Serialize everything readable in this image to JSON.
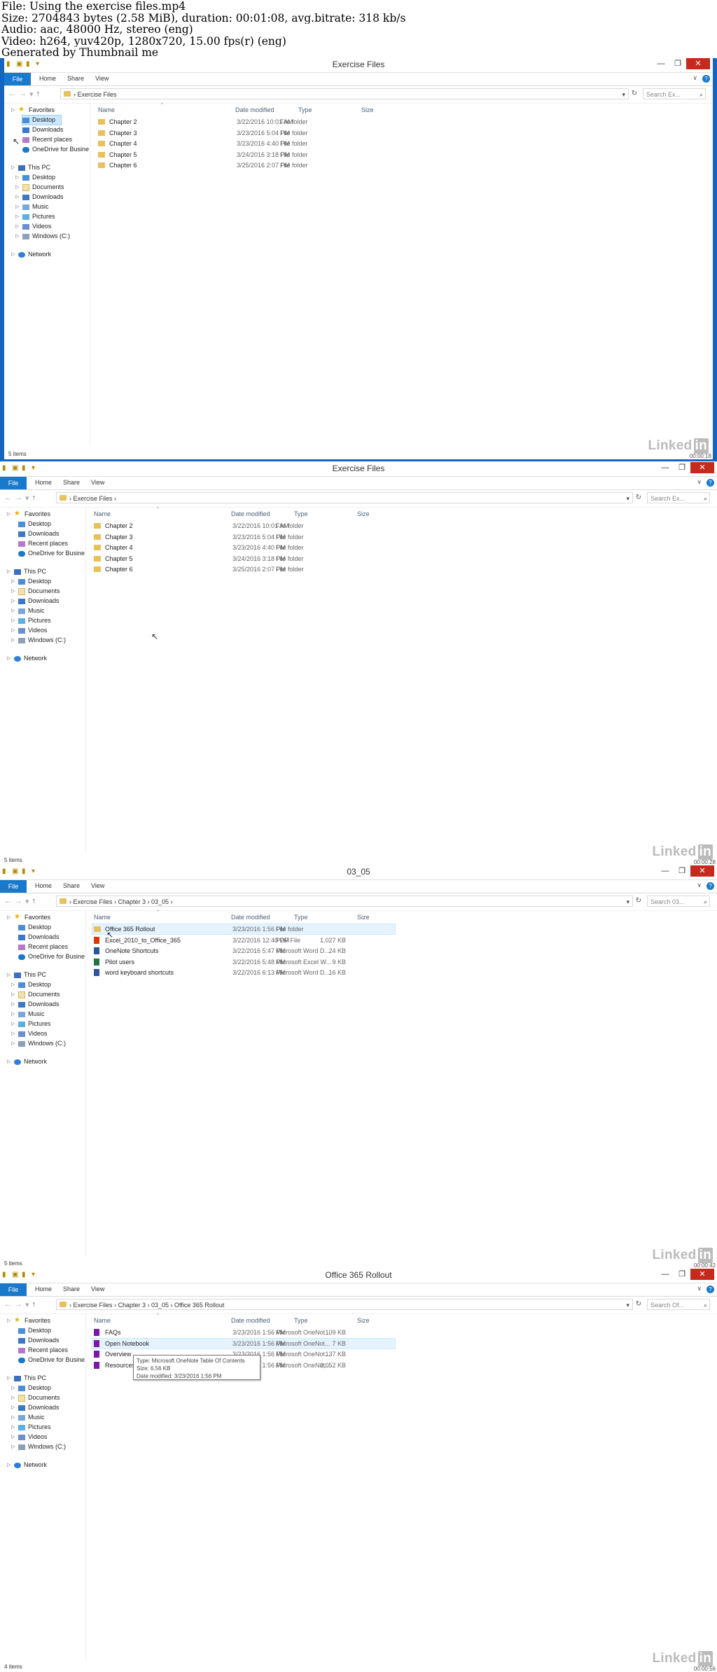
{
  "header": {
    "line1": "File: Using the exercise files.mp4",
    "line2": "Size: 2704843 bytes (2.58 MiB), duration: 00:01:08, avg.bitrate: 318 kb/s",
    "line3": "Audio: aac, 48000 Hz, stereo (eng)",
    "line4": "Video: h264, yuv420p, 1280x720, 15.00 fps(r) (eng)",
    "line5": "Generated by Thumbnail me"
  },
  "ribbon": {
    "file": "File",
    "home": "Home",
    "share": "Share",
    "view": "View"
  },
  "columns": {
    "name": "Name",
    "date": "Date modified",
    "type": "Type",
    "size": "Size"
  },
  "nav_pane": {
    "favorites": "Favorites",
    "desktop": "Desktop",
    "downloads": "Downloads",
    "recent": "Recent places",
    "onedrive": "OneDrive for Busine",
    "thispc": "This PC",
    "pc_desktop": "Desktop",
    "documents": "Documents",
    "pc_downloads": "Downloads",
    "music": "Music",
    "pictures": "Pictures",
    "videos": "Videos",
    "drive_c": "Windows (C:)",
    "network": "Network"
  },
  "branding": {
    "logo_text": "Linked",
    "logo_in": "in"
  },
  "frames": [
    {
      "title": "Exercise Files",
      "address": "›  Exercise Files",
      "search_placeholder": "Search Ex...",
      "status": "5 items",
      "timestamp": "00:00:18",
      "rows": [
        {
          "name": "Chapter 2",
          "date": "3/22/2016 10:01 AM",
          "type": "File folder",
          "size": ""
        },
        {
          "name": "Chapter 3",
          "date": "3/23/2016 5:04 PM",
          "type": "File folder",
          "size": ""
        },
        {
          "name": "Chapter 4",
          "date": "3/23/2016 4:40 PM",
          "type": "File folder",
          "size": ""
        },
        {
          "name": "Chapter 5",
          "date": "3/24/2016 3:18 PM",
          "type": "File folder",
          "size": ""
        },
        {
          "name": "Chapter 6",
          "date": "3/25/2016 2:07 PM",
          "type": "File folder",
          "size": ""
        }
      ]
    },
    {
      "title": "Exercise Files",
      "address": "›  Exercise Files  ›",
      "search_placeholder": "Search Ex...",
      "status": "5 items",
      "timestamp": "00:00:28",
      "rows": [
        {
          "name": "Chapter 2",
          "date": "3/22/2016 10:01 AM",
          "type": "File folder",
          "size": ""
        },
        {
          "name": "Chapter 3",
          "date": "3/23/2016 5:04 PM",
          "type": "File folder",
          "size": ""
        },
        {
          "name": "Chapter 4",
          "date": "3/23/2016 4:40 PM",
          "type": "File folder",
          "size": ""
        },
        {
          "name": "Chapter 5",
          "date": "3/24/2016 3:18 PM",
          "type": "File folder",
          "size": ""
        },
        {
          "name": "Chapter 6",
          "date": "3/25/2016 2:07 PM",
          "type": "File folder",
          "size": ""
        }
      ]
    },
    {
      "title": "03_05",
      "address": "›  Exercise Files  ›  Chapter 3  ›  03_05  ›",
      "search_placeholder": "Search 03...",
      "status": "5 items",
      "timestamp": "00:00:42",
      "rows": [
        {
          "name": "Office 365 Rollout",
          "date": "3/23/2016 1:56 PM",
          "type": "File folder",
          "size": ""
        },
        {
          "name": "Excel_2010_to_Office_365",
          "date": "3/22/2016 12:40 PM",
          "type": "PDF File",
          "size": "1,027 KB"
        },
        {
          "name": "OneNote Shortcuts",
          "date": "3/22/2016 5:47 PM",
          "type": "Microsoft Word D...",
          "size": "24 KB"
        },
        {
          "name": "Pilot users",
          "date": "3/22/2016 5:48 PM",
          "type": "Microsoft Excel W...",
          "size": "9 KB"
        },
        {
          "name": "word keyboard shortcuts",
          "date": "3/22/2016 6:13 PM",
          "type": "Microsoft Word D...",
          "size": "16 KB"
        }
      ]
    },
    {
      "title": "Office 365 Rollout",
      "address": "›  Exercise Files  ›  Chapter 3  ›  03_05  ›  Office 365 Rollout",
      "search_placeholder": "Search Of...",
      "status": "4 items",
      "timestamp": "00:00:56",
      "rows": [
        {
          "name": "FAQs",
          "date": "3/23/2016 1:56 PM",
          "type": "Microsoft OneNot...",
          "size": "109 KB"
        },
        {
          "name": "Open Notebook",
          "date": "3/23/2016 1:56 PM",
          "type": "Microsoft OneNot...",
          "size": "7 KB"
        },
        {
          "name": "Overview",
          "date": "3/23/2016 1:56 PM",
          "type": "Microsoft OneNot...",
          "size": "137 KB"
        },
        {
          "name": "Resources",
          "date": "3/23/2016 1:56 PM",
          "type": "Microsoft OneNot...",
          "size": "2,052 KB"
        }
      ]
    }
  ],
  "tooltip": {
    "line1": "Type: Microsoft OneNote Table Of Contents",
    "line2": "Size: 6.56 KB",
    "line3": "Date modified: 3/23/2016 1:56 PM"
  }
}
